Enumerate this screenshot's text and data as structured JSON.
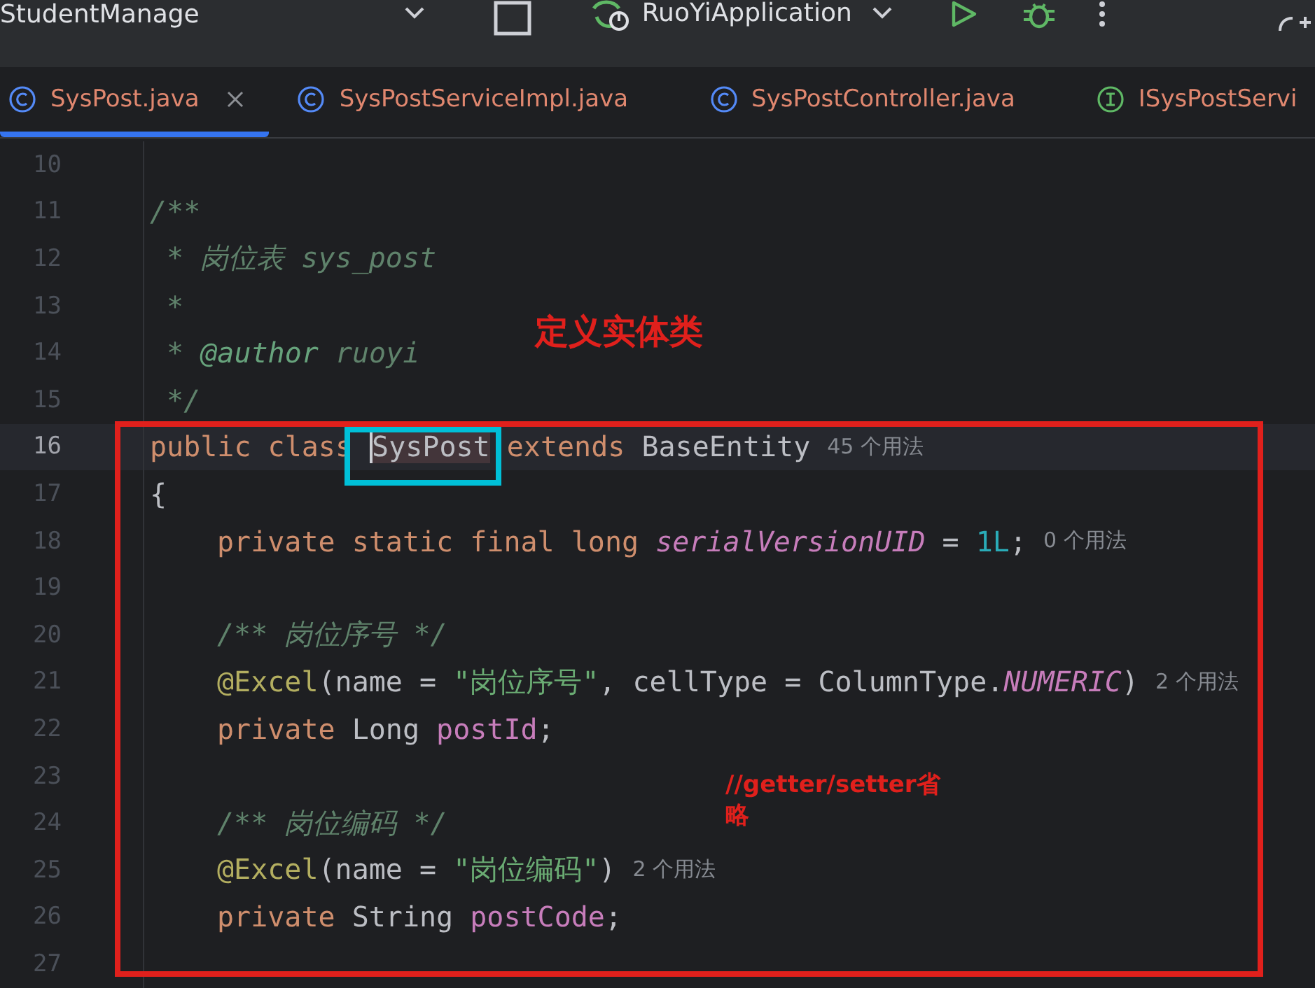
{
  "toolbar": {
    "project": "StudentManage",
    "run_config": "RuoYiApplication"
  },
  "tabs": [
    {
      "label": "SysPost.java",
      "kind": "class",
      "selected": true
    },
    {
      "label": "SysPostServiceImpl.java",
      "kind": "class",
      "selected": false
    },
    {
      "label": "SysPostController.java",
      "kind": "class",
      "selected": false
    },
    {
      "label": "ISysPostServi",
      "kind": "interface",
      "selected": false
    }
  ],
  "editor": {
    "lines": [
      {
        "number": "10",
        "current": false
      },
      {
        "number": "11",
        "current": false,
        "tokens": [
          {
            "text": "/**",
            "kind": "doc"
          }
        ]
      },
      {
        "number": "12",
        "current": false,
        "tokens": [
          {
            "text": " * 岗位表 sys_post",
            "kind": "doc"
          }
        ]
      },
      {
        "number": "13",
        "current": false,
        "tokens": [
          {
            "text": " *",
            "kind": "doc"
          }
        ]
      },
      {
        "number": "14",
        "current": false,
        "tokens": [
          {
            "text": " * ",
            "kind": "doc"
          },
          {
            "text": "@author",
            "kind": "doc-tag"
          },
          {
            "text": " ruoyi",
            "kind": "doc"
          }
        ]
      },
      {
        "number": "15",
        "current": false,
        "tokens": [
          {
            "text": " */",
            "kind": "doc"
          }
        ]
      },
      {
        "number": "16",
        "current": true,
        "tokens": [
          {
            "text": "public class ",
            "kind": "keyword"
          },
          {
            "text": "SysPost",
            "kind": "usage-highlight"
          },
          {
            "text": " extends",
            "kind": "keyword"
          },
          {
            "text": " BaseEntity",
            "kind": "plain"
          }
        ],
        "hint": "45 个用法"
      },
      {
        "number": "17",
        "current": false,
        "tokens": [
          {
            "text": "{",
            "kind": "plain"
          }
        ],
        "children": [
          {
            "number": "18",
            "current": false,
            "tokens": [
              {
                "text": "private static final long ",
                "kind": "keyword"
              },
              {
                "text": "serialVersionUID",
                "kind": "static-field"
              },
              {
                "text": " = ",
                "kind": "plain"
              },
              {
                "text": "1L",
                "kind": "number"
              },
              {
                "text": ";",
                "kind": "plain"
              }
            ],
            "hint": "0 个用法"
          },
          {
            "number": "19",
            "current": false
          },
          {
            "number": "20",
            "current": false,
            "tokens": [
              {
                "text": "/** 岗位序号 */",
                "kind": "doc"
              }
            ]
          },
          {
            "number": "21",
            "current": false,
            "tokens": [
              {
                "text": "@Excel",
                "kind": "annotation"
              },
              {
                "text": "(name = ",
                "kind": "plain"
              },
              {
                "text": "\"岗位序号\"",
                "kind": "string"
              },
              {
                "text": ", cellType = ColumnType.",
                "kind": "plain"
              },
              {
                "text": "NUMERIC",
                "kind": "static-field"
              },
              {
                "text": ")",
                "kind": "plain"
              }
            ],
            "hint": "2 个用法"
          },
          {
            "number": "22",
            "current": false,
            "tokens": [
              {
                "text": "private ",
                "kind": "keyword"
              },
              {
                "text": "Long ",
                "kind": "plain"
              },
              {
                "text": "postId",
                "kind": "field"
              },
              {
                "text": ";",
                "kind": "plain"
              }
            ]
          },
          {
            "number": "23",
            "current": false
          },
          {
            "number": "24",
            "current": false,
            "tokens": [
              {
                "text": "/** 岗位编码 */",
                "kind": "doc"
              }
            ]
          },
          {
            "number": "25",
            "current": false,
            "tokens": [
              {
                "text": "@Excel",
                "kind": "annotation"
              },
              {
                "text": "(name = ",
                "kind": "plain"
              },
              {
                "text": "\"岗位编码\"",
                "kind": "string"
              },
              {
                "text": ")",
                "kind": "plain"
              }
            ],
            "hint": "2 个用法"
          },
          {
            "number": "26",
            "current": false,
            "tokens": [
              {
                "text": "private ",
                "kind": "keyword"
              },
              {
                "text": "String ",
                "kind": "plain"
              },
              {
                "text": "postCode",
                "kind": "field"
              },
              {
                "text": ";",
                "kind": "plain"
              }
            ]
          },
          {
            "number": "27",
            "current": false
          }
        ]
      }
    ]
  },
  "annotations": {
    "title": "定义实体类",
    "note": "//getter/setter省略"
  }
}
